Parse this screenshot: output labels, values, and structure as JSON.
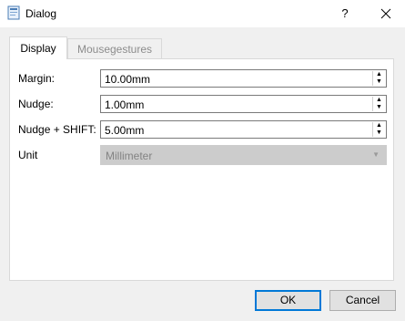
{
  "window": {
    "title": "Dialog",
    "help_label": "?",
    "icons": {
      "app": "dialog-app-icon",
      "close": "close-icon"
    }
  },
  "tabs": [
    {
      "label": "Display",
      "active": true
    },
    {
      "label": "Mousegestures",
      "active": false
    }
  ],
  "fields": {
    "margin": {
      "label": "Margin:",
      "value": "10.00mm"
    },
    "nudge": {
      "label": "Nudge:",
      "value": "1.00mm"
    },
    "nudge_shift": {
      "label": "Nudge + SHIFT:",
      "value": "5.00mm"
    },
    "unit": {
      "label": "Unit",
      "value": "Millimeter",
      "enabled": false
    }
  },
  "buttons": {
    "ok": "OK",
    "cancel": "Cancel"
  },
  "colors": {
    "accent": "#0078d7",
    "panel": "#ffffff",
    "dialog_bg": "#f0f0f0"
  }
}
